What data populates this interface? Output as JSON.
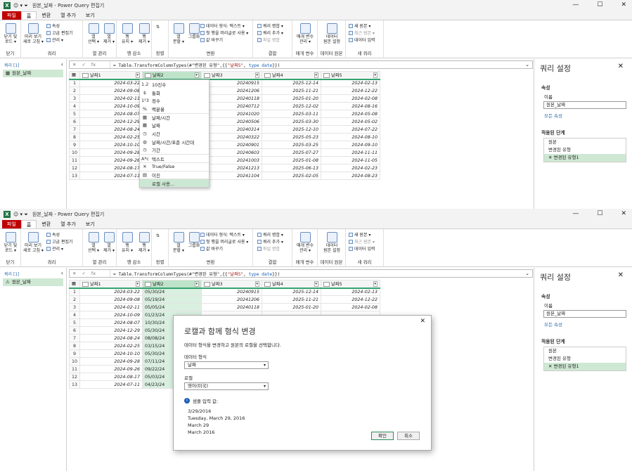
{
  "title": "원본_날짜 - Power Query 편집기",
  "tabs": [
    "파일",
    "홈",
    "변환",
    "열 추가",
    "보기"
  ],
  "ribbon": {
    "close": {
      "b": "닫기 및\n로드 ▾",
      "g": "닫기"
    },
    "query": {
      "preview": "미리 보기\n새로 고침 ▾",
      "props": "속성",
      "adv": "고급 편집기",
      "manage": "관리 ▾",
      "g": "쿼리"
    },
    "colmgmt": {
      "select": "열\n선택 ▾",
      "remove": "열\n제거 ▾",
      "g": "열 관리"
    },
    "rows": {
      "keep": "행\n유지 ▾",
      "remove": "행\n제거 ▾",
      "g": "행 감소"
    },
    "sort": {
      "g": "정렬"
    },
    "transform": {
      "split": "열\n분할 ▾",
      "group": "그룹화",
      "dtype": "데이터 형식: 텍스트 ▾",
      "header": "첫 행을 머리글로 사용 ▾",
      "replace": "값 바꾸기",
      "g": "변환"
    },
    "combine": {
      "merge": "쿼리 병합 ▾",
      "append": "쿼리 추가 ▾",
      "files": "파일 병합",
      "g": "결합"
    },
    "params": {
      "b": "매개 변수\n관리 ▾",
      "g": "매개 변수"
    },
    "ds": {
      "b": "데이터\n원본 설정",
      "g": "데이터 원본"
    },
    "nq": {
      "new": "새 원본 ▾",
      "recent": "최근 원본 ▾",
      "enter": "데이터 입력",
      "g": "새 쿼리"
    }
  },
  "queries": {
    "header": "쿼리 [1]",
    "item": "원본_날짜"
  },
  "formula": {
    "pre": "= Table.TransformColumnTypes(#\"변경된 유형\",{{",
    "str": "\"날짜5\"",
    "mid": ", ",
    "kw": "type date",
    "post": "}})",
    "text": "Table.TransformColumnTypes(#\"변경된 유형\",{{\"날짜5\", type date}})"
  },
  "columns": [
    "날짜1",
    "날짜2",
    "날짜3",
    "날짜4",
    "날짜5"
  ],
  "rows": [
    [
      "2024-03-22",
      "",
      "20240915",
      "2025-12-14",
      "2024-02-13"
    ],
    [
      "2024-09-08",
      "",
      "20241206",
      "2025-11-21",
      "2024-12-22"
    ],
    [
      "2024-02-11",
      "",
      "20240118",
      "2025-01-20",
      "2024-02-08"
    ],
    [
      "2024-10-09",
      "",
      "20240712",
      "2025-12-02",
      "2024-08-16"
    ],
    [
      "2024-08-07",
      "",
      "20241020",
      "2025-03-11",
      "2024-05-08"
    ],
    [
      "2024-12-29",
      "",
      "20240506",
      "2025-03-30",
      "2024-05-02"
    ],
    [
      "2024-08-24",
      "",
      "20240314",
      "2025-12-10",
      "2024-07-22"
    ],
    [
      "2024-02-25",
      "",
      "20240322",
      "2025-05-23",
      "2024-08-10"
    ],
    [
      "2024-10-10",
      "",
      "20240901",
      "2025-03-25",
      "2024-09-10"
    ],
    [
      "2024-09-28",
      "",
      "20240603",
      "2025-07-27",
      "2024-11-11"
    ],
    [
      "2024-09-26",
      "",
      "20241003",
      "2025-01-08",
      "2024-11-05"
    ],
    [
      "2024-08-17",
      "",
      "20241213",
      "2025-06-13",
      "2024-02-23"
    ],
    [
      "2024-07-11",
      "",
      "20241104",
      "2025-02-05",
      "2024-08-23"
    ]
  ],
  "col2_bottom": [
    "05/30/24",
    "05/19/24",
    "05/05/24",
    "01/23/24",
    "10/30/24",
    "05/30/24",
    "08/08/24",
    "03/15/24",
    "05/30/24",
    "07/11/24",
    "09/22/24",
    "05/03/24",
    "04/23/24"
  ],
  "type_menu": [
    {
      "icon": "1.2",
      "label": "10진수"
    },
    {
      "icon": "$",
      "label": "통화"
    },
    {
      "icon": "1²3",
      "label": "정수"
    },
    {
      "icon": "%",
      "label": "백분율"
    },
    {
      "icon": "▦",
      "label": "날짜/시간"
    },
    {
      "icon": "▦",
      "label": "날짜"
    },
    {
      "icon": "◷",
      "label": "시간"
    },
    {
      "icon": "◍",
      "label": "날짜/시간/표준 시간대"
    },
    {
      "icon": "◷",
      "label": "기간"
    },
    {
      "icon": "Aᴮc",
      "label": "텍스트"
    },
    {
      "icon": "✕",
      "label": "True/False"
    },
    {
      "icon": "▤",
      "label": "이진"
    },
    {
      "icon": "",
      "label": "로캘 사용..."
    }
  ],
  "settings": {
    "title": "쿼리 설정",
    "props": "속성",
    "name_label": "이름",
    "name": "원본_날짜",
    "all_props": "모든 속성",
    "steps_title": "적용된 단계",
    "steps": [
      "원본",
      "변경된 유형",
      "변경된 유형1"
    ]
  },
  "dialog": {
    "title": "로캘과 함께 형식 변경",
    "desc": "데이터 형식을 변경하고 원본의 로캘을 선택합니다.",
    "dtype_label": "데이터 형식",
    "dtype": "날짜",
    "locale_label": "로캘",
    "locale": "영어(미국)",
    "sample_label": "샘플 입력 값:",
    "samples": [
      "3/29/2016",
      "Tuesday, March 29, 2016",
      "March 29",
      "March 2016"
    ],
    "ok": "확인",
    "cancel": "취소"
  }
}
